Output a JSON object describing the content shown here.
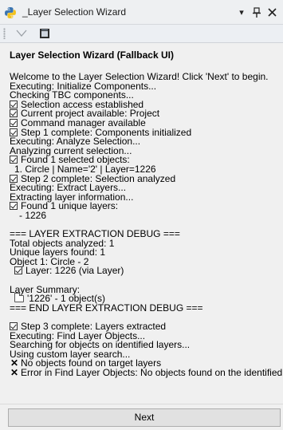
{
  "window": {
    "title": "_Layer Selection Wizard",
    "controls": {
      "menu": "▾",
      "pin": "📌",
      "close": "✕"
    }
  },
  "toolbar": {
    "dropdown_icon": "chevron-down-icon",
    "tool_icon": "window-icon"
  },
  "main": {
    "heading": "Layer Selection Wizard (Fallback UI)",
    "log": [
      {
        "text": "Welcome to the Layer Selection Wizard! Click 'Next' to begin.",
        "icon": ""
      },
      {
        "text": "Executing: Initialize Components...",
        "icon": ""
      },
      {
        "text": "Checking TBC components...",
        "icon": ""
      },
      {
        "text": "Selection access established",
        "icon": "check"
      },
      {
        "text": "Current project available: Project",
        "icon": "check"
      },
      {
        "text": "Command manager available",
        "icon": "check"
      },
      {
        "text": "Step 1 complete: Components initialized",
        "icon": "check"
      },
      {
        "text": "Executing: Analyze Selection...",
        "icon": ""
      },
      {
        "text": "Analyzing current selection...",
        "icon": ""
      },
      {
        "text": "Found 1 selected objects:",
        "icon": "check"
      },
      {
        "text": "1. Circle | Name='2' | Layer=1226",
        "icon": "",
        "indent": 1
      },
      {
        "text": "Step 2 complete: Selection analyzed",
        "icon": "check"
      },
      {
        "text": "Executing: Extract Layers...",
        "icon": ""
      },
      {
        "text": "Extracting layer information...",
        "icon": ""
      },
      {
        "text": "Found 1 unique layers:",
        "icon": "check"
      },
      {
        "text": "- 1226",
        "icon": "",
        "indent": 2
      },
      {
        "text": "",
        "icon": ""
      },
      {
        "text": "=== LAYER EXTRACTION DEBUG ===",
        "icon": ""
      },
      {
        "text": "Total objects analyzed: 1",
        "icon": ""
      },
      {
        "text": "Unique layers found: 1",
        "icon": ""
      },
      {
        "text": "Object 1: Circle - 2",
        "icon": ""
      },
      {
        "text": "Layer: 1226 (via Layer)",
        "icon": "check",
        "indent": 1
      },
      {
        "text": "",
        "icon": ""
      },
      {
        "text": "Layer Summary:",
        "icon": ""
      },
      {
        "text": "'1226' - 1 object(s)",
        "icon": "folder",
        "indent": 1
      },
      {
        "text": "=== END LAYER EXTRACTION DEBUG ===",
        "icon": ""
      },
      {
        "text": "",
        "icon": ""
      },
      {
        "text": "Step 3 complete: Layers extracted",
        "icon": "check"
      },
      {
        "text": "Executing: Find Layer Objects...",
        "icon": ""
      },
      {
        "text": "Searching for objects on identified layers...",
        "icon": ""
      },
      {
        "text": "Using custom layer search...",
        "icon": ""
      },
      {
        "text": "No objects found on target layers",
        "icon": "x"
      },
      {
        "text": "Error in Find Layer Objects: No objects found on the identified layers",
        "icon": "x"
      }
    ]
  },
  "footer": {
    "next_label": "Next"
  }
}
